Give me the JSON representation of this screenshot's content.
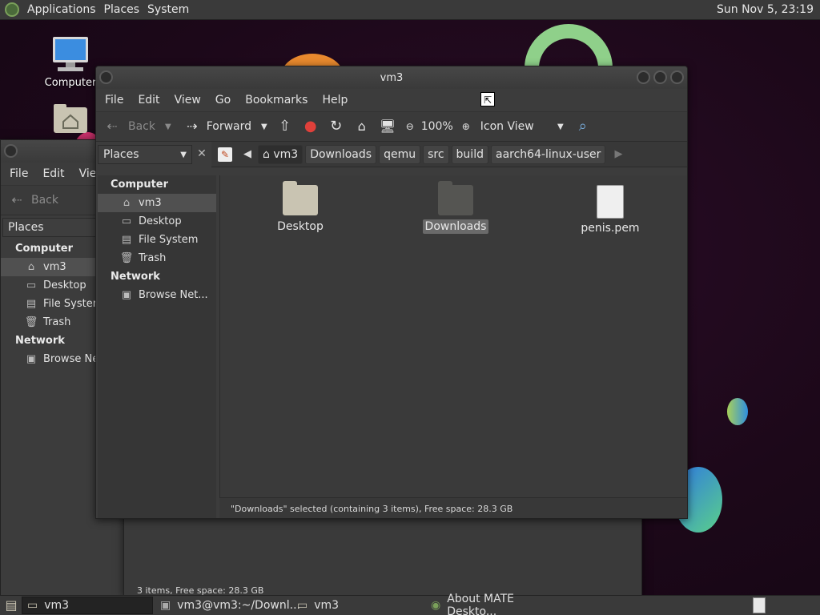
{
  "top_panel": {
    "menus": [
      "Applications",
      "Places",
      "System"
    ],
    "clock": "Sun Nov 5, 23:19"
  },
  "desktop_icons": [
    {
      "label": "Computer",
      "icon": "computer-icon"
    },
    {
      "label": "",
      "icon": "home-folder-icon"
    }
  ],
  "back_window": {
    "menus": [
      "File",
      "Edit",
      "View"
    ],
    "back_label": "Back",
    "places_combo": "Places",
    "sidebar": {
      "computer_head": "Computer",
      "items": [
        "vm3",
        "Desktop",
        "File System",
        "Trash"
      ],
      "network_head": "Network",
      "network_items": [
        "Browse Net"
      ]
    },
    "status": "3 items, Free space: 28.3 GB"
  },
  "main_window": {
    "title": "vm3",
    "menus": [
      "File",
      "Edit",
      "View",
      "Go",
      "Bookmarks",
      "Help"
    ],
    "toolbar": {
      "back": "Back",
      "forward": "Forward",
      "zoom": "100%",
      "view_mode": "Icon View"
    },
    "sidebar_combo": "Places",
    "breadcrumbs": [
      "vm3",
      "Downloads",
      "qemu",
      "src",
      "build",
      "aarch64-linux-user"
    ],
    "sidebar": {
      "computer_head": "Computer",
      "items": [
        "vm3",
        "Desktop",
        "File System",
        "Trash"
      ],
      "network_head": "Network",
      "network_items": [
        "Browse Net..."
      ]
    },
    "files": [
      {
        "name": "Desktop",
        "type": "folder"
      },
      {
        "name": "Downloads",
        "type": "folder",
        "selected": true
      },
      {
        "name": "penis.pem",
        "type": "file"
      }
    ],
    "status": "\"Downloads\" selected (containing 3 items), Free space: 28.3 GB"
  },
  "taskbar": {
    "tasks": [
      "vm3",
      "vm3@vm3:~/Downl...",
      "vm3",
      "About MATE Deskto..."
    ]
  },
  "colors": {
    "panel": "#3a3a3a",
    "window": "#3c3c3c",
    "content": "#3a3a3a",
    "accent_green": "#7aa05a"
  }
}
